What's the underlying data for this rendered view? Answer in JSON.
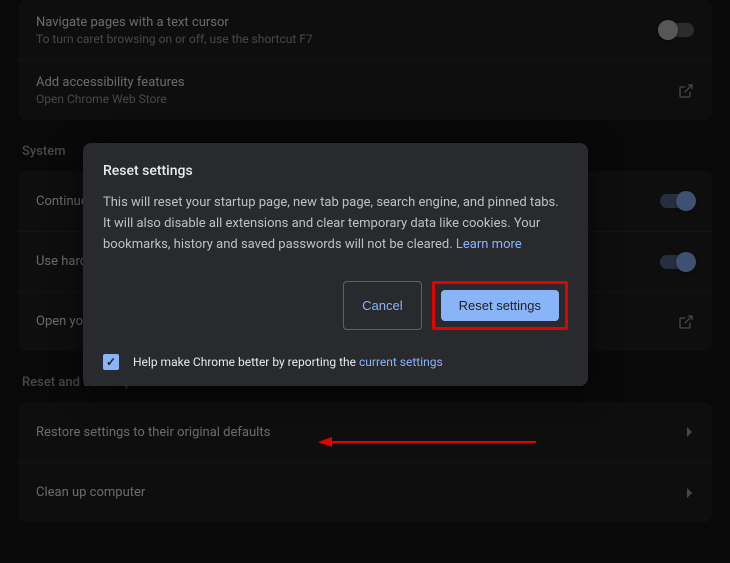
{
  "rows": {
    "caret_title": "Navigate pages with a text cursor",
    "caret_sub": "To turn caret browsing on or off, use the shortcut F7",
    "a11y_title": "Add accessibility features",
    "a11y_sub": "Open Chrome Web Store",
    "bg_title": "Continue running background apps when Google Chrome is closed",
    "hw_title": "Use hardware acceleration when available",
    "proxy_title": "Open your computer's proxy settings",
    "restore_title": "Restore settings to their original defaults",
    "cleanup_title": "Clean up computer"
  },
  "sections": {
    "system": "System",
    "reset": "Reset and clean up"
  },
  "dialog": {
    "title": "Reset settings",
    "body": "This will reset your startup page, new tab page, search engine, and pinned tabs. It will also disable all extensions and clear temporary data like cookies. Your bookmarks, history and saved passwords will not be cleared. ",
    "learn_more": "Learn more",
    "cancel": "Cancel",
    "confirm": "Reset settings",
    "footer_pre": "Help make Chrome better by reporting the ",
    "footer_link": "current settings",
    "checked": true
  }
}
